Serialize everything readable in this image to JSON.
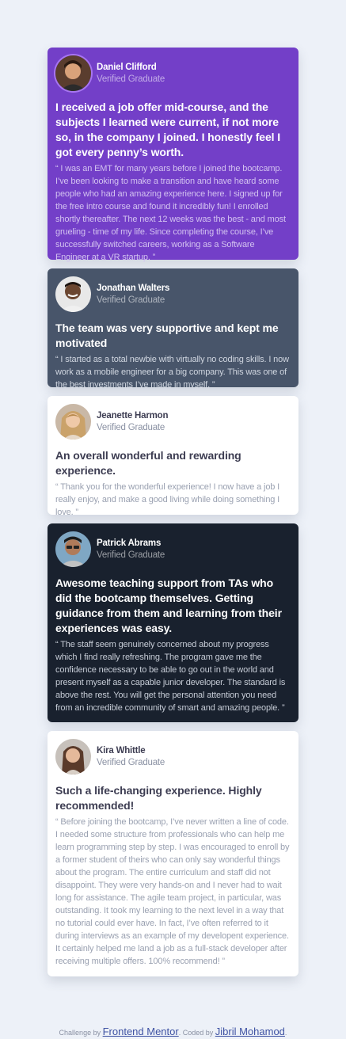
{
  "testimonials": [
    {
      "name": "Daniel Clifford",
      "status": "Verified Graduate",
      "headline": "I received a job offer mid-course, and the subjects I learned were current, if not more so, in the company I joined. I honestly feel I got every penny’s worth.",
      "quote": "“ I was an EMT for many years before I joined the bootcamp. I’ve been looking to make a transition and have heard some people who had an amazing experience here. I signed up for the free intro course and found it incredibly fun! I enrolled shortly thereafter. The next 12 weeks was the best - and most grueling - time of my life. Since completing the course, I’ve successfully switched careers, working as a Software Engineer at a VR startup. ”"
    },
    {
      "name": "Jonathan Walters",
      "status": "Verified Graduate",
      "headline": "The team was very supportive and kept me motivated",
      "quote": "“ I started as a total newbie with virtually no coding skills. I now work as a mobile engineer for a big company. This was one of the best investments I’ve made in myself. ”"
    },
    {
      "name": "Jeanette Harmon",
      "status": "Verified Graduate",
      "headline": "An overall wonderful and rewarding experience.",
      "quote": "“ Thank you for the wonderful experience! I now have a job I really enjoy, and make a good living while doing something I love. ”"
    },
    {
      "name": "Patrick Abrams",
      "status": "Verified Graduate",
      "headline": "Awesome teaching support from TAs who did the bootcamp themselves. Getting guidance from them and learning from their experiences was easy.",
      "quote": "“ The staff seem genuinely concerned about my progress which I find really refreshing. The program gave me the confidence necessary to be able to go out in the world and present myself as a capable junior developer. The standard is above the rest. You will get the personal attention you need from an incredible community of smart and amazing people. ”"
    },
    {
      "name": "Kira Whittle",
      "status": "Verified Graduate",
      "headline": "Such a life-changing experience. Highly recommended!",
      "quote": "“ Before joining the bootcamp, I’ve never written a line of code. I needed some structure from professionals who can help me learn programming step by step. I was encouraged to enroll by a former student of theirs who can only say wonderful things about the program. The entire curriculum and staff did not disappoint. They were very hands-on and I never had to wait long for assistance. The agile team project, in particular, was outstanding. It took my learning to the next level in a way that no tutorial could ever have. In fact, I’ve often referred to it during interviews as an example of my developent experience. It certainly helped me land a job as a full-stack developer after receiving multiple offers. 100% recommend! ”"
    }
  ],
  "footer": {
    "challenge_prefix": "Challenge by",
    "challenge_link": "Frontend Mentor",
    "coded_prefix": ". Coded by",
    "coded_link": "Jibril Mohamod",
    "suffix": "."
  },
  "colors": {
    "background": "#edf1f8",
    "purple": "#733fc8",
    "grey": "#48556a",
    "white": "#ffffff",
    "dark": "#19212e"
  }
}
